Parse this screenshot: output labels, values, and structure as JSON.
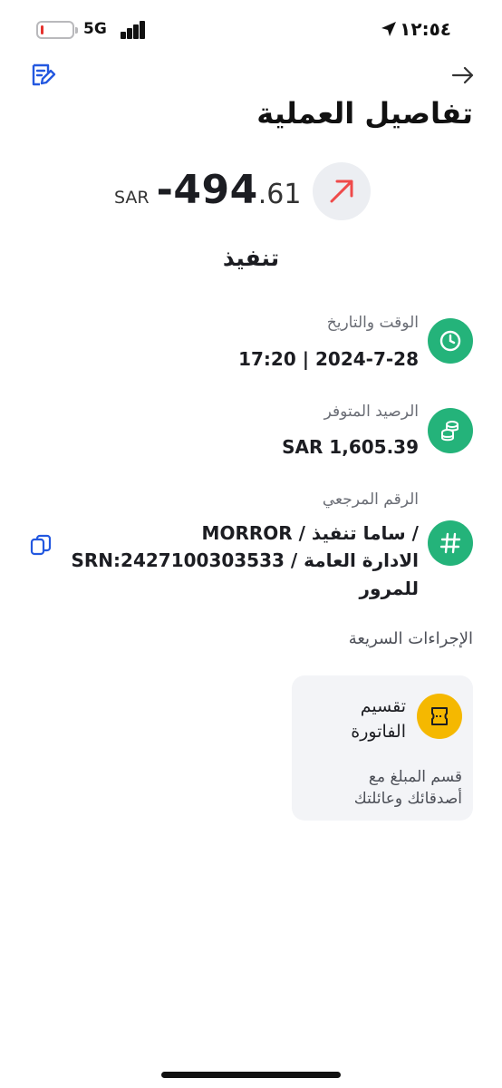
{
  "status_bar": {
    "time": "١٢:٥٤",
    "network": "5G",
    "battery_level": 0.1,
    "battery_color": "#e5322d"
  },
  "header": {
    "title": "تفاصيل العملية",
    "left_icon": "edit-receipt-icon",
    "right_icon": "arrow-right-icon"
  },
  "transaction": {
    "currency": "SAR",
    "amount_int": "-494",
    "amount_dec": ".61",
    "direction_icon": "outgoing-arrow-icon",
    "direction_color": "#ef4a4a",
    "merchant": "تنفيذ"
  },
  "details": [
    {
      "label": "الوقت والتاريخ",
      "value": "2024-7-28 | 17:20",
      "icon": "clock-icon"
    },
    {
      "label": "الرصيد المتوفر",
      "value": "SAR 1,605.39",
      "icon": "coins-icon"
    },
    {
      "label": "الرقم المرجعي",
      "icon": "hash-icon",
      "lines": [
        "MORROR / ساما تنفيذ /",
        "SRN:2427100303533 / الادارة العامة",
        "للمرور"
      ],
      "action_icon": "copy-icon"
    }
  ],
  "quick_actions": {
    "title": "الإجراءات السريعة",
    "items": [
      {
        "title_line1": "تقسيم",
        "title_line2": "الفاتورة",
        "desc_line1": "قسم المبلغ مع",
        "desc_line2": "أصدقائك وعائلتك",
        "icon": "split-bill-icon"
      }
    ]
  },
  "colors": {
    "accent_green": "#24b37a",
    "accent_yellow": "#f5b800",
    "link_blue": "#2358e0"
  }
}
